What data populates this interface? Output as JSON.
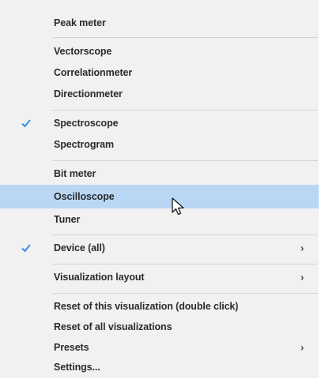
{
  "menu": {
    "items": {
      "peak_meter": "Peak meter",
      "vectorscope": "Vectorscope",
      "correlationmeter": "Correlationmeter",
      "directionmeter": "Directionmeter",
      "spectroscope": "Spectroscope",
      "spectrogram": "Spectrogram",
      "bit_meter": "Bit meter",
      "oscilloscope": "Oscilloscope",
      "tuner": "Tuner",
      "device": "Device (all)",
      "visualization_layout": "Visualization layout",
      "reset_this": "Reset of this visualization (double click)",
      "reset_all": "Reset of all visualizations",
      "presets": "Presets",
      "settings": "Settings..."
    },
    "submenu_arrow": "›",
    "checked": [
      "Spectroscope",
      "Device (all)"
    ],
    "highlighted": "Oscilloscope",
    "colors": {
      "highlight": "#b9d7f5",
      "check": "#3a8ee6",
      "background": "#f1f1f1",
      "separator": "#d4d4d4"
    }
  }
}
